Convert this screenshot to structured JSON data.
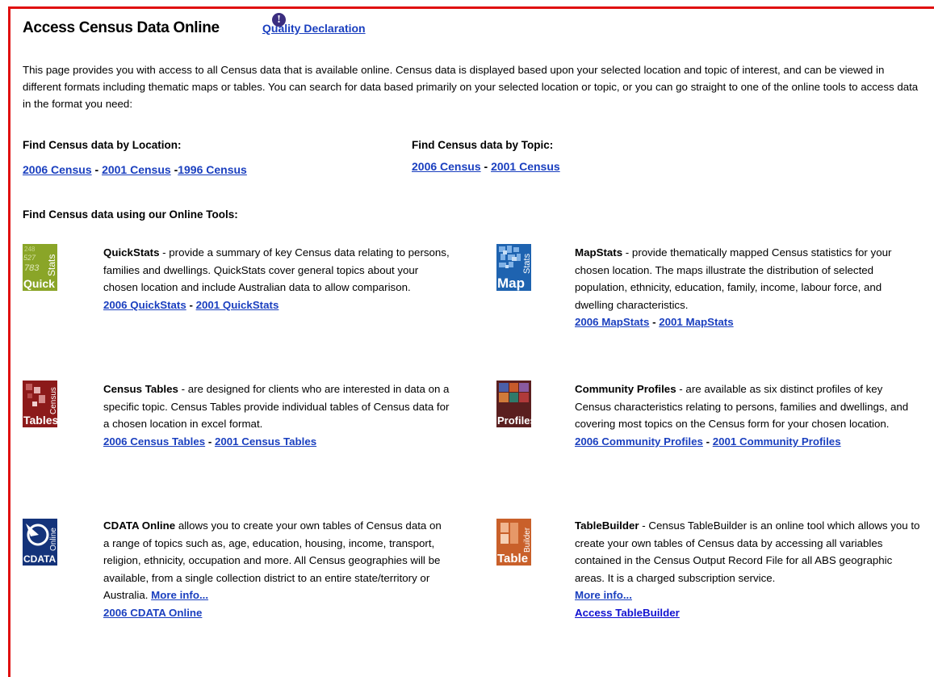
{
  "header": {
    "title": "Access Census Data Online",
    "quality_link": "Quality Declaration",
    "info_glyph": "!"
  },
  "intro": {
    "text": "This page provides you with access to all Census data that is available online. Census data is displayed based upon your selected location and topic of interest, and can be viewed in different formats including thematic maps or tables. You can search for data based primarily on your selected location or topic, or you can go straight to one of the online tools to access data in the format you need:"
  },
  "by_location": {
    "heading": "Find Census data by Location:",
    "links": [
      "2006 Census",
      "2001 Census",
      "1996 Census"
    ]
  },
  "by_topic": {
    "heading": "Find Census data by Topic:",
    "links": [
      "2006 Census",
      "2001 Census"
    ]
  },
  "tools_heading": "Find Census data using our Online Tools:",
  "separator": "-",
  "tools": {
    "quickstats": {
      "icon": "quickstats-logo-icon",
      "logo_main": "Quick",
      "logo_side": "Stats",
      "logo_numbers": [
        "248",
        "527",
        "783"
      ],
      "name": "QuickStats",
      "desc": " - provide a summary of key Census data relating to persons, families and dwellings. QuickStats cover general topics about your chosen location and include Australian data to allow comparison.",
      "links": [
        "2006 QuickStats",
        "2001 QuickStats"
      ]
    },
    "mapstats": {
      "icon": "mapstats-logo-icon",
      "logo_main": "Map",
      "logo_side": "Stats",
      "name": "MapStats",
      "desc": " - provide thematically mapped Census statistics for your chosen location. The maps illustrate the distribution of selected population, ethnicity, education, family, income, labour force, and dwelling characteristics.",
      "links": [
        "2006 MapStats",
        "2001 MapStats"
      ]
    },
    "census_tables": {
      "icon": "census-tables-logo-icon",
      "logo_main": "Tables",
      "logo_side": "Census",
      "name": "Census Tables",
      "desc": " - are designed for clients who are interested in data on a specific topic. Census Tables provide individual tables of Census data for a chosen location in excel format.",
      "links": [
        "2006 Census Tables",
        "2001 Census Tables"
      ]
    },
    "community_profiles": {
      "icon": "community-profiles-logo-icon",
      "logo_main": "Profiles",
      "name": "Community Profiles",
      "desc": " - are available as six distinct profiles of key Census characteristics relating to persons, families and dwellings, and covering most topics on the Census form for your chosen location.",
      "links": [
        "2006 Community Profiles",
        "2001 Community Profiles"
      ]
    },
    "cdata": {
      "icon": "cdata-online-logo-icon",
      "logo_main": "CDATA",
      "logo_side": "Online",
      "name": "CDATA Online",
      "desc": " allows you to create your own tables of Census data on a range of topics such as, age, education, housing, income, transport, religion, ethnicity, occupation and more. All Census geographies will be available, from a single collection district to an entire state/territory or Australia. ",
      "more": "More info...",
      "links": [
        "2006 CDATA Online"
      ]
    },
    "tablebuilder": {
      "icon": "tablebuilder-logo-icon",
      "logo_main": "Table",
      "logo_side": "Builder",
      "name": "TableBuilder",
      "desc": " - Census TableBuilder is an online tool which allows you to create your own tables of Census data by accessing all variables contained in the Census Output Record File for all ABS geographic areas. It is a charged subscription service.",
      "more": "More info...",
      "access": "Access TableBuilder"
    }
  },
  "colors": {
    "border": "#e01010",
    "link": "#1a3fbf",
    "quickstats": "#8aa528",
    "mapstats": "#1e63b0",
    "census_tables": "#8c1a1a",
    "community_profiles": "#5a1f1f",
    "cdata": "#14337a",
    "tablebuilder": "#c9602a"
  }
}
